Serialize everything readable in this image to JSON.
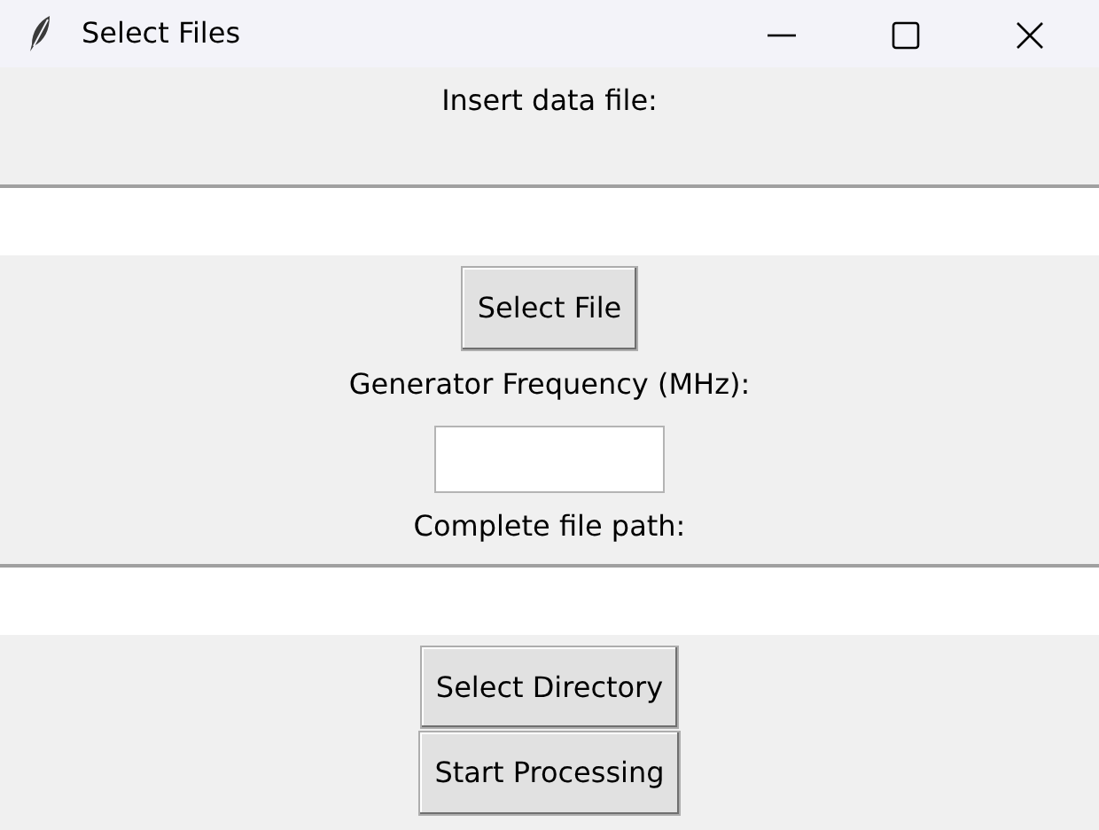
{
  "window": {
    "title": "Select Files"
  },
  "items": [
    {
      "kind": "label",
      "text": "Insert data file:"
    },
    {
      "kind": "wide_field"
    },
    {
      "kind": "button",
      "text": "Select File"
    },
    {
      "kind": "label",
      "text": "Generator Frequency (MHz):"
    },
    {
      "kind": "field"
    },
    {
      "kind": "label",
      "text": "Complete file path:"
    },
    {
      "kind": "wide_field"
    },
    {
      "kind": "button",
      "text": "Select Directory"
    },
    {
      "kind": "button",
      "text": "Start Processing"
    }
  ]
}
